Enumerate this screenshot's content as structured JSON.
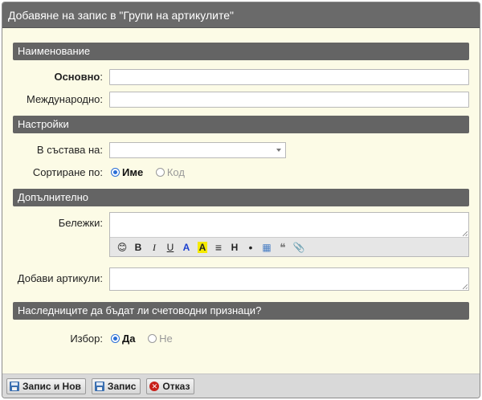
{
  "window": {
    "title": "Добавяне на запис в \"Групи на артикулите\""
  },
  "sections": {
    "naming": {
      "header": "Наименование",
      "primary_label": "Основно",
      "primary_colon": ":",
      "international_label": "Международно:"
    },
    "settings": {
      "header": "Настройки",
      "parent_label": "В състава на:",
      "sort_label": "Сортиране по:",
      "sort_options": [
        {
          "label": "Име",
          "checked": true
        },
        {
          "label": "Код",
          "checked": false
        }
      ]
    },
    "additional": {
      "header": "Допълнително",
      "notes_label": "Бележки:",
      "add_items_label": "Добави артикули:"
    },
    "accounting": {
      "header": "Наследниците да бъдат ли счетоводни признаци?",
      "choice_label": "Избор:",
      "choice_options": [
        {
          "label": "Да",
          "checked": true
        },
        {
          "label": "Не",
          "checked": false
        }
      ]
    }
  },
  "editor_toolbar": [
    {
      "icon": "emoji-icon",
      "glyph": "😊"
    },
    {
      "icon": "bold-icon",
      "glyph": "B"
    },
    {
      "icon": "italic-icon",
      "glyph": "I"
    },
    {
      "icon": "underline-icon",
      "glyph": "U"
    },
    {
      "icon": "font-color-icon",
      "glyph": "A"
    },
    {
      "icon": "highlight-icon",
      "glyph": "A"
    },
    {
      "icon": "align-icon",
      "glyph": "≡"
    },
    {
      "icon": "heading-icon",
      "glyph": "H"
    },
    {
      "icon": "bullet-list-icon",
      "glyph": "•"
    },
    {
      "icon": "table-icon",
      "glyph": "▦"
    },
    {
      "icon": "quote-icon",
      "glyph": "❝"
    },
    {
      "icon": "attachment-icon",
      "glyph": "📎"
    }
  ],
  "footer": {
    "save_and_new": "Запис и Нов",
    "save": "Запис",
    "cancel": "Отказ"
  },
  "colors": {
    "background": "#fcfbe6",
    "header": "#646464",
    "radio_accent": "#2b6fd6",
    "cancel_icon": "#c8201a"
  }
}
